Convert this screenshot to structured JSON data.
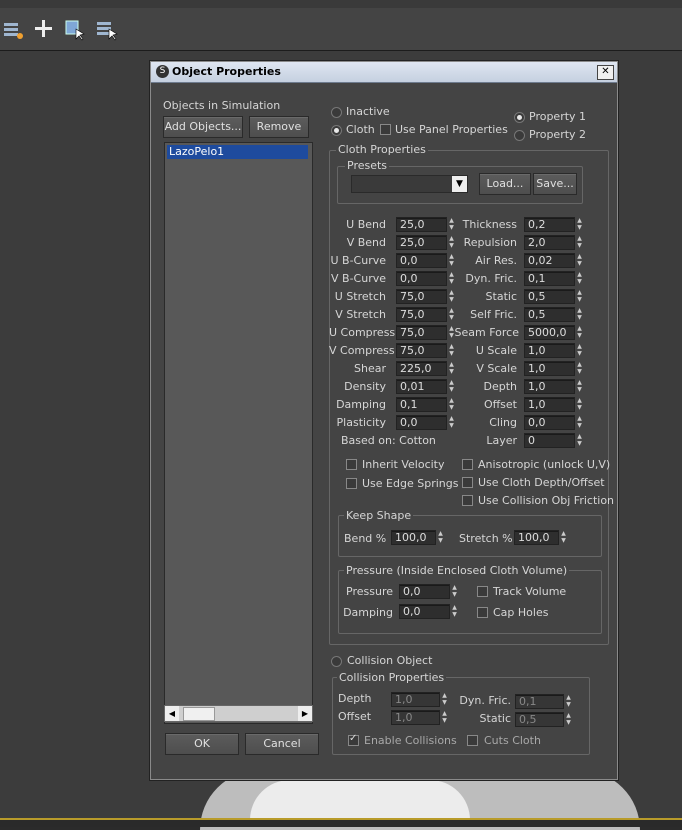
{
  "dialog": {
    "title": "Object Properties",
    "close_label": "✕",
    "ok_label": "OK",
    "cancel_label": "Cancel"
  },
  "objects": {
    "label": "Objects in Simulation",
    "add_label": "Add Objects...",
    "remove_label": "Remove",
    "items": [
      "LazoPelo1"
    ]
  },
  "mode": {
    "inactive": "Inactive",
    "cloth": "Cloth",
    "use_panel": "Use Panel Properties",
    "property1": "Property 1",
    "property2": "Property 2",
    "collision_object": "Collision Object"
  },
  "cloth": {
    "title": "Cloth Properties",
    "presets_title": "Presets",
    "load_label": "Load...",
    "save_label": "Save...",
    "left": [
      {
        "label": "U Bend",
        "value": "25,0"
      },
      {
        "label": "V Bend",
        "value": "25,0"
      },
      {
        "label": "U B-Curve",
        "value": "0,0"
      },
      {
        "label": "V B-Curve",
        "value": "0,0"
      },
      {
        "label": "U Stretch",
        "value": "75,0"
      },
      {
        "label": "V Stretch",
        "value": "75,0"
      },
      {
        "label": "U Compress",
        "value": "75,0"
      },
      {
        "label": "V Compress",
        "value": "75,0"
      },
      {
        "label": "Shear",
        "value": "225,0"
      },
      {
        "label": "Density",
        "value": "0,01"
      },
      {
        "label": "Damping",
        "value": "0,1"
      },
      {
        "label": "Plasticity",
        "value": "0,0"
      }
    ],
    "right": [
      {
        "label": "Thickness",
        "value": "0,2"
      },
      {
        "label": "Repulsion",
        "value": "2,0"
      },
      {
        "label": "Air Res.",
        "value": "0,02"
      },
      {
        "label": "Dyn. Fric.",
        "value": "0,1"
      },
      {
        "label": "Static",
        "value": "0,5"
      },
      {
        "label": "Self Fric.",
        "value": "0,5"
      },
      {
        "label": "Seam Force",
        "value": "5000,0"
      },
      {
        "label": "U Scale",
        "value": "1,0"
      },
      {
        "label": "V Scale",
        "value": "1,0"
      },
      {
        "label": "Depth",
        "value": "1,0"
      },
      {
        "label": "Offset",
        "value": "1,0"
      },
      {
        "label": "Cling",
        "value": "0,0"
      },
      {
        "label": "Layer",
        "value": "0"
      }
    ],
    "based_on": "Based on: Cotton",
    "inherit_velocity": "Inherit Velocity",
    "anisotropic": "Anisotropic (unlock U,V)",
    "use_edge_springs": "Use Edge Springs",
    "use_cloth_depth": "Use Cloth Depth/Offset",
    "use_collision_friction": "Use Collision Obj Friction"
  },
  "keep_shape": {
    "title": "Keep Shape",
    "bend_label": "Bend %",
    "bend_value": "100,0",
    "stretch_label": "Stretch %",
    "stretch_value": "100,0"
  },
  "pressure": {
    "title": "Pressure (Inside Enclosed Cloth Volume)",
    "pressure_label": "Pressure",
    "pressure_value": "0,0",
    "damping_label": "Damping",
    "damping_value": "0,0",
    "track_volume": "Track Volume",
    "cap_holes": "Cap Holes"
  },
  "collision": {
    "title": "Collision Properties",
    "depth_label": "Depth",
    "depth_value": "1,0",
    "offset_label": "Offset",
    "offset_value": "1,0",
    "dynfric_label": "Dyn. Fric.",
    "dynfric_value": "0,1",
    "static_label": "Static",
    "static_value": "0,5",
    "enable_collisions": "Enable Collisions",
    "cuts_cloth": "Cuts Cloth"
  },
  "colors": {
    "panel": "#444444",
    "selection": "#1e4b9e",
    "accent_line": "#b89b2a"
  }
}
